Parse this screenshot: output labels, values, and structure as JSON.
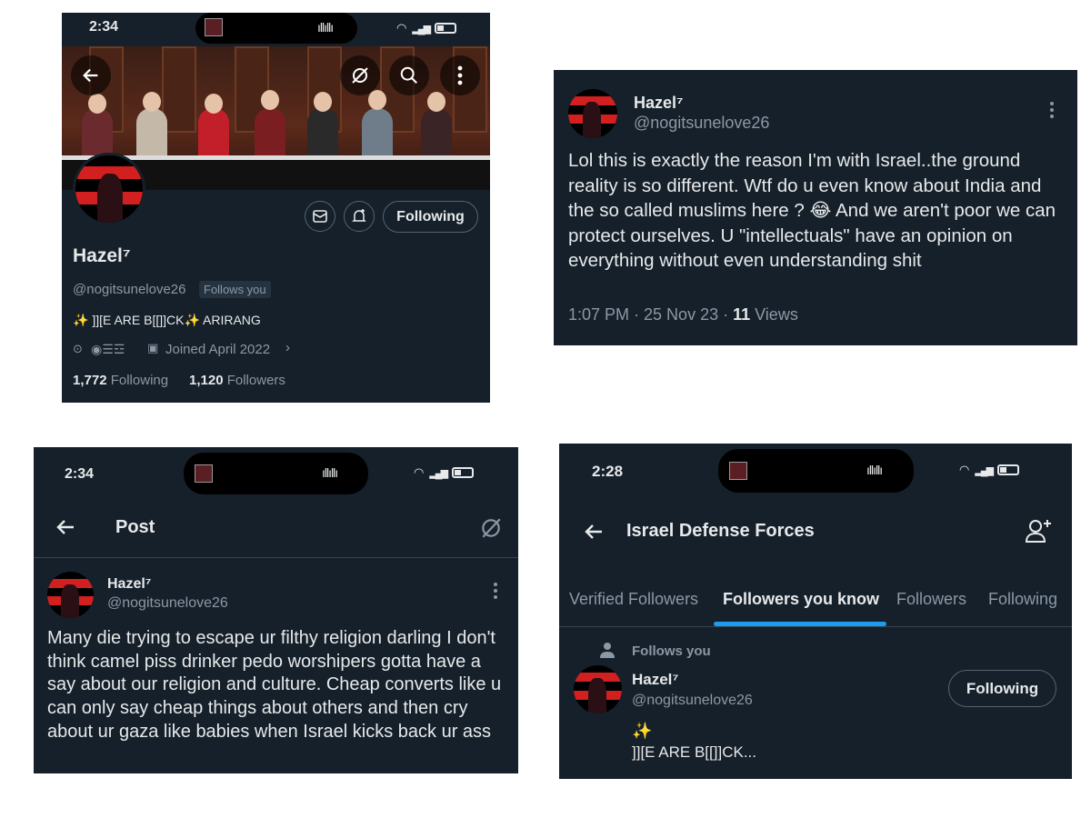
{
  "panel1": {
    "time": "2:34",
    "name": "Hazel⁷",
    "handle": "@nogitsunelove26",
    "follows_you": "Follows you",
    "bio": "✨ ]][E ARE B[[]]CK✨ ARIRANG",
    "location": "◉☰☲",
    "joined": "Joined April 2022",
    "following_count": "1,772",
    "following_label": "Following",
    "followers_count": "1,120",
    "followers_label": "Followers",
    "following_button": "Following",
    "icons": [
      "back-arrow-icon",
      "hide-icon",
      "search-icon",
      "more-vertical-icon",
      "mail-icon",
      "bell-plus-icon",
      "location-icon",
      "calendar-icon"
    ]
  },
  "panel2": {
    "name": "Hazel⁷",
    "handle": "@nogitsunelove26",
    "text": "Lol this is exactly the reason I'm with Israel..the ground reality is so different. Wtf do u even know about India and the so called muslims here ? 😂 And we aren't poor we can protect ourselves. U \"intellectuals\" have an opinion on everything without even understanding shit",
    "meta_time": "1:07 PM · 25 Nov 23 · ",
    "views_count": "11",
    "views_label": " Views"
  },
  "panel3": {
    "time": "2:34",
    "title": "Post",
    "name": "Hazel⁷",
    "handle": "@nogitsunelove26",
    "text": "Many die trying to escape ur filthy religion darling I don't think camel piss drinker pedo worshipers gotta have a say about our religion and culture. Cheap converts like u can only say cheap things about others and then cry about ur gaza like babies when Israel kicks back ur ass"
  },
  "panel4": {
    "time": "2:28",
    "title": "Israel Defense Forces",
    "tabs": [
      "Verified Followers",
      "Followers you know",
      "Followers",
      "Following"
    ],
    "active_tab": 1,
    "follows_you": "Follows you",
    "name": "Hazel⁷",
    "handle": "@nogitsunelove26",
    "bio_line1": "✨",
    "bio_line2": "]][E ARE B[[]]CK...",
    "following_button": "Following"
  },
  "colors": {
    "background": "#15202b",
    "accent": "#1d9bf0",
    "muted": "#8b98a5",
    "text": "#e7e9ea"
  }
}
